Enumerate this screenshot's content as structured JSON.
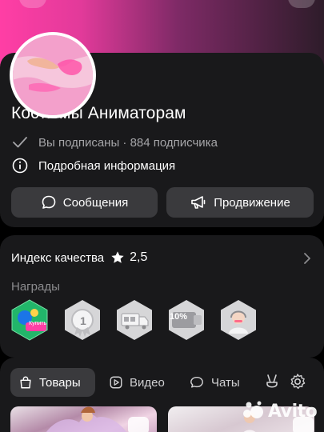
{
  "profile": {
    "name": "Костюмы Аниматорам",
    "subscribed_text": "Вы подписаны · 884 подписчика",
    "info_text": "Подробная информация",
    "buttons": {
      "messages": "Сообщения",
      "promotion": "Продвижение"
    }
  },
  "quality": {
    "label": "Индекс качества",
    "value": "2,5",
    "awards_label": "Награды",
    "badges": [
      {
        "name": "buy-badge",
        "text": "Купить"
      },
      {
        "name": "one-year-badge",
        "text": "1"
      },
      {
        "name": "delivery-badge",
        "text": ""
      },
      {
        "name": "discount-badge",
        "text": "10%"
      },
      {
        "name": "support-badge",
        "text": ""
      }
    ]
  },
  "tabs": [
    {
      "label": "Товары",
      "icon": "bag-icon",
      "active": true
    },
    {
      "label": "Видео",
      "icon": "play-icon",
      "active": false
    },
    {
      "label": "Чаты",
      "icon": "chat-icon",
      "active": false
    }
  ],
  "watermark": "Avito",
  "colors": {
    "background": "#000000",
    "card": "#19191b",
    "button": "#3a3a3d",
    "secondary_text": "#a5a5a8",
    "cover_pink": "#ff3ea5"
  }
}
